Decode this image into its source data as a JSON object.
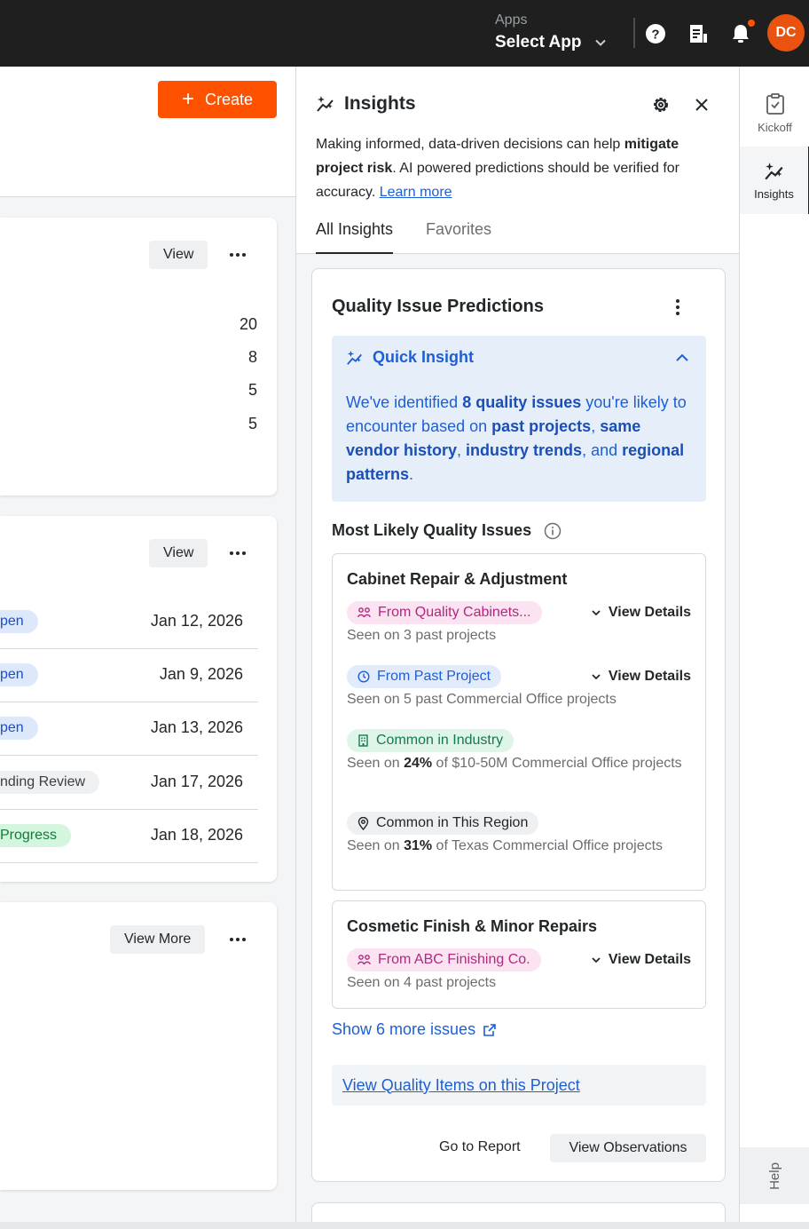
{
  "topbar": {
    "apps_label": "Apps",
    "select_app": "Select App",
    "avatar_initials": "DC",
    "avatar_color": "#e9530f"
  },
  "left": {
    "create_label": "Create",
    "card1": {
      "view_label": "View",
      "counts": [
        "20",
        "8",
        "5",
        "5"
      ]
    },
    "card2": {
      "view_label": "View",
      "rows": [
        {
          "status": "pen",
          "date": "Jan 12, 2026"
        },
        {
          "status": "pen",
          "date": "Jan 9, 2026"
        },
        {
          "status": "pen",
          "date": "Jan 13, 2026"
        },
        {
          "status": "nding Review",
          "date": "Jan 17, 2026"
        },
        {
          "status": "Progress",
          "date": "Jan 18, 2026"
        }
      ]
    },
    "card3": {
      "view_more_label": "View More"
    }
  },
  "insights": {
    "title": "Insights",
    "desc_part1": "Making informed, data-driven decisions can help ",
    "desc_bold": "mitigate project risk",
    "desc_part2": ". AI powered predictions should be verified for accuracy. ",
    "learn_more": "Learn more",
    "tabs": [
      "All Insights",
      "Favorites"
    ],
    "card_title": "Quality Issue Predictions",
    "quick_insight": {
      "title": "Quick Insight",
      "t1": "We've identified ",
      "b1": "8 quality issues",
      "t2": " you're likely to encounter based on ",
      "b2": "past projects",
      "t3": ", ",
      "b3": "same vendor history",
      "t4": ", ",
      "b4": "industry trends",
      "t5": ", and ",
      "b5": "regional patterns",
      "t6": "."
    },
    "most_likely_title": "Most Likely Quality Issues",
    "issue1": {
      "title": "Cabinet Repair & Adjustment",
      "tag1": "From Quality Cabinets...",
      "seen1": "Seen on 3 past projects",
      "tag2": "From Past Project",
      "seen2": "Seen on 5 past Commercial Office projects",
      "tag3": "Common in Industry",
      "seen3_pre": "Seen on ",
      "seen3_bold": "24%",
      "seen3_post": " of $10-50M Commercial Office projects",
      "tag4": "Common in This Region",
      "seen4_pre": "Seen on ",
      "seen4_bold": "31%",
      "seen4_post": " of Texas Commercial Office projects",
      "view_details": "View Details"
    },
    "issue2": {
      "title": "Cosmetic Finish & Minor Repairs",
      "tag1": "From ABC Finishing Co.",
      "seen1": "Seen on 4 past projects",
      "view_details": "View Details"
    },
    "show_more": "Show 6 more issues",
    "view_quality": "View Quality Items on this Project",
    "go_to_report": "Go to Report",
    "view_observations": "View Observations"
  },
  "rail": {
    "kickoff": "Kickoff",
    "insights": "Insights",
    "help": "Help"
  }
}
